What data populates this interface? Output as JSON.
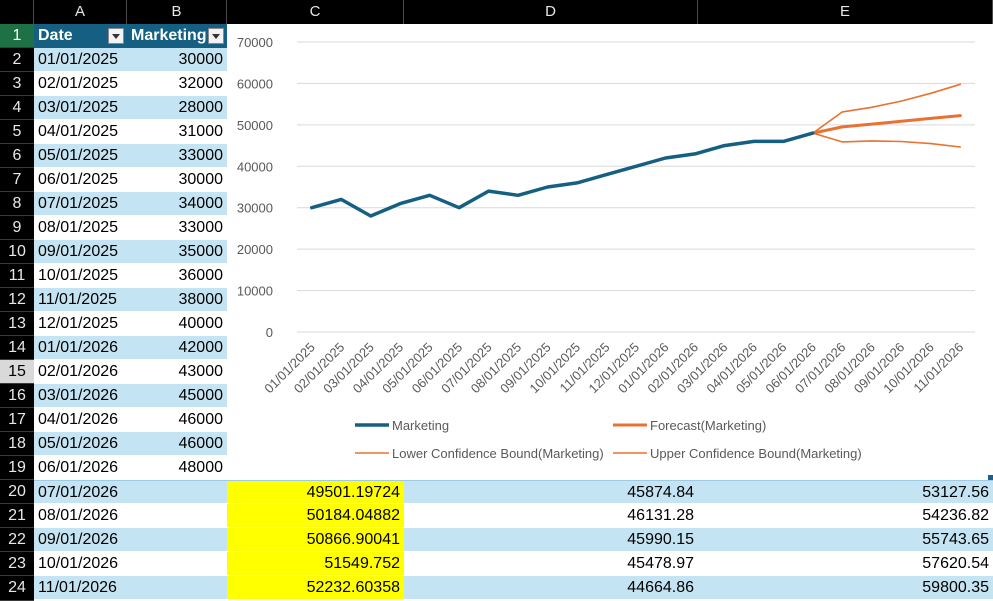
{
  "columns": [
    "A",
    "B",
    "C",
    "D",
    "E"
  ],
  "table": {
    "headers": [
      "Date",
      "Marketing"
    ],
    "rows": [
      {
        "row": "1"
      },
      {
        "row": "2",
        "date": "01/01/2025",
        "value": "30000"
      },
      {
        "row": "3",
        "date": "02/01/2025",
        "value": "32000"
      },
      {
        "row": "4",
        "date": "03/01/2025",
        "value": "28000"
      },
      {
        "row": "5",
        "date": "04/01/2025",
        "value": "31000"
      },
      {
        "row": "6",
        "date": "05/01/2025",
        "value": "33000"
      },
      {
        "row": "7",
        "date": "06/01/2025",
        "value": "30000"
      },
      {
        "row": "8",
        "date": "07/01/2025",
        "value": "34000"
      },
      {
        "row": "9",
        "date": "08/01/2025",
        "value": "33000"
      },
      {
        "row": "10",
        "date": "09/01/2025",
        "value": "35000"
      },
      {
        "row": "11",
        "date": "10/01/2025",
        "value": "36000"
      },
      {
        "row": "12",
        "date": "11/01/2025",
        "value": "38000"
      },
      {
        "row": "13",
        "date": "12/01/2025",
        "value": "40000"
      },
      {
        "row": "14",
        "date": "01/01/2026",
        "value": "42000"
      },
      {
        "row": "15",
        "date": "02/01/2026",
        "value": "43000"
      },
      {
        "row": "16",
        "date": "03/01/2026",
        "value": "45000"
      },
      {
        "row": "17",
        "date": "04/01/2026",
        "value": "46000"
      },
      {
        "row": "18",
        "date": "05/01/2026",
        "value": "46000"
      },
      {
        "row": "19",
        "date": "06/01/2026",
        "value": "48000"
      }
    ]
  },
  "forecast_rows": [
    {
      "row": "20",
      "date": "07/01/2026",
      "forecast": "49501.19724",
      "lower": "45874.84",
      "upper": "53127.56"
    },
    {
      "row": "21",
      "date": "08/01/2026",
      "forecast": "50184.04882",
      "lower": "46131.28",
      "upper": "54236.82"
    },
    {
      "row": "22",
      "date": "09/01/2026",
      "forecast": "50866.90041",
      "lower": "45990.15",
      "upper": "55743.65"
    },
    {
      "row": "23",
      "date": "10/01/2026",
      "forecast": "51549.752",
      "lower": "45478.97",
      "upper": "57620.54"
    },
    {
      "row": "24",
      "date": "11/01/2026",
      "forecast": "52232.60358",
      "lower": "44664.86",
      "upper": "59800.35"
    }
  ],
  "chart_data": {
    "type": "line",
    "categories": [
      "01/01/2025",
      "02/01/2025",
      "03/01/2025",
      "04/01/2025",
      "05/01/2025",
      "06/01/2025",
      "07/01/2025",
      "08/01/2025",
      "09/01/2025",
      "10/01/2025",
      "11/01/2025",
      "12/01/2025",
      "01/01/2026",
      "02/01/2026",
      "03/01/2026",
      "04/01/2026",
      "05/01/2026",
      "06/01/2026",
      "07/01/2026",
      "08/01/2026",
      "09/01/2026",
      "10/01/2026",
      "11/01/2026"
    ],
    "ylim": [
      0,
      70000
    ],
    "yticks": [
      "0",
      "10000",
      "20000",
      "30000",
      "40000",
      "50000",
      "60000",
      "70000"
    ],
    "grid": true,
    "legend_position": "bottom",
    "series": [
      {
        "name": "Marketing",
        "color": "#156082",
        "width": 3.5,
        "values": [
          30000,
          32000,
          28000,
          31000,
          33000,
          30000,
          34000,
          33000,
          35000,
          36000,
          38000,
          40000,
          42000,
          43000,
          45000,
          46000,
          46000,
          48000,
          null,
          null,
          null,
          null,
          null
        ]
      },
      {
        "name": "Forecast(Marketing)",
        "color": "#e97132",
        "width": 3,
        "values": [
          null,
          null,
          null,
          null,
          null,
          null,
          null,
          null,
          null,
          null,
          null,
          null,
          null,
          null,
          null,
          null,
          null,
          48000,
          49501.19724,
          50184.04882,
          50866.90041,
          51549.752,
          52232.60358
        ]
      },
      {
        "name": "Lower Confidence Bound(Marketing)",
        "color": "#e97132",
        "width": 1.6,
        "values": [
          null,
          null,
          null,
          null,
          null,
          null,
          null,
          null,
          null,
          null,
          null,
          null,
          null,
          null,
          null,
          null,
          null,
          48000,
          45874.84,
          46131.28,
          45990.15,
          45478.97,
          44664.86
        ]
      },
      {
        "name": "Upper Confidence Bound(Marketing)",
        "color": "#e97132",
        "width": 1.6,
        "values": [
          null,
          null,
          null,
          null,
          null,
          null,
          null,
          null,
          null,
          null,
          null,
          null,
          null,
          null,
          null,
          null,
          null,
          48000,
          53127.56,
          54236.82,
          55743.65,
          57620.54,
          59800.35
        ]
      }
    ]
  },
  "colors": {
    "header_fill": "#156082",
    "band_fill": "#c5e4f3",
    "highlight": "#ffff00"
  }
}
